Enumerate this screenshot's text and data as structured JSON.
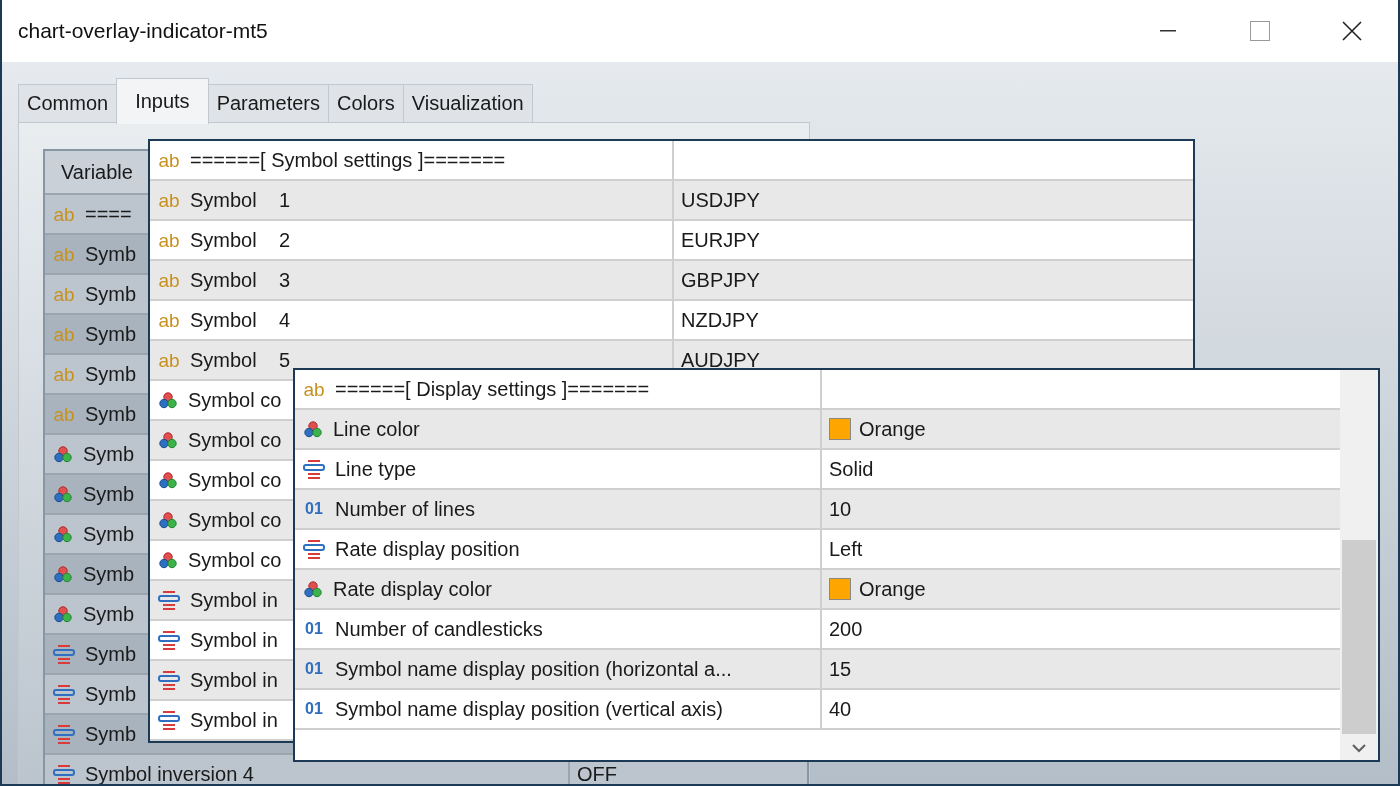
{
  "window": {
    "title": "chart-overlay-indicator-mt5"
  },
  "tabs": [
    {
      "label": "Common",
      "selected": false
    },
    {
      "label": "Inputs",
      "selected": true
    },
    {
      "label": "Parameters",
      "selected": false
    },
    {
      "label": "Colors",
      "selected": false
    },
    {
      "label": "Visualization",
      "selected": false
    }
  ],
  "background_table": {
    "columns": [
      "Variable"
    ],
    "rows": [
      {
        "kind": "string",
        "icon_text": "ab",
        "variable": "===="
      },
      {
        "kind": "string",
        "icon_text": "ab",
        "variable": "Symb"
      },
      {
        "kind": "string",
        "icon_text": "ab",
        "variable": "Symb"
      },
      {
        "kind": "string",
        "icon_text": "ab",
        "variable": "Symb"
      },
      {
        "kind": "string",
        "icon_text": "ab",
        "variable": "Symb"
      },
      {
        "kind": "string",
        "icon_text": "ab",
        "variable": "Symb"
      },
      {
        "kind": "color",
        "variable": "Symb"
      },
      {
        "kind": "color",
        "variable": "Symb"
      },
      {
        "kind": "color",
        "variable": "Symb"
      },
      {
        "kind": "color",
        "variable": "Symb"
      },
      {
        "kind": "color",
        "variable": "Symb"
      },
      {
        "kind": "enum",
        "variable": "Symb"
      },
      {
        "kind": "enum",
        "variable": "Symb"
      },
      {
        "kind": "enum",
        "variable": "Symb"
      },
      {
        "kind": "enum",
        "variable": "Symbol inversion 4",
        "value": "OFF"
      }
    ]
  },
  "symbol_settings_panel": {
    "rows": [
      {
        "kind": "string",
        "icon_text": "ab",
        "variable": "======[ Symbol settings ]======="
      },
      {
        "kind": "string",
        "icon_text": "ab",
        "variable": "Symbol    1",
        "value": "USDJPY"
      },
      {
        "kind": "string",
        "icon_text": "ab",
        "variable": "Symbol    2",
        "value": "EURJPY"
      },
      {
        "kind": "string",
        "icon_text": "ab",
        "variable": "Symbol    3",
        "value": "GBPJPY"
      },
      {
        "kind": "string",
        "icon_text": "ab",
        "variable": "Symbol    4",
        "value": "NZDJPY"
      },
      {
        "kind": "string",
        "icon_text": "ab",
        "variable": "Symbol    5",
        "value": "AUDJPY"
      },
      {
        "kind": "color",
        "variable": "Symbol co"
      },
      {
        "kind": "color",
        "variable": "Symbol co"
      },
      {
        "kind": "color",
        "variable": "Symbol co"
      },
      {
        "kind": "color",
        "variable": "Symbol co"
      },
      {
        "kind": "color",
        "variable": "Symbol co"
      },
      {
        "kind": "enum",
        "variable": "Symbol in"
      },
      {
        "kind": "enum",
        "variable": "Symbol in"
      },
      {
        "kind": "enum",
        "variable": "Symbol in"
      },
      {
        "kind": "enum",
        "variable": "Symbol in"
      }
    ]
  },
  "display_settings_panel": {
    "rows": [
      {
        "kind": "string",
        "icon_text": "ab",
        "variable": "======[ Display settings ]======="
      },
      {
        "kind": "color",
        "variable": "Line color",
        "value": "Orange",
        "color": "#ffa500"
      },
      {
        "kind": "enum",
        "variable": "Line type",
        "value": "Solid"
      },
      {
        "kind": "int",
        "icon_text": "01",
        "variable": "Number of lines",
        "value": "10"
      },
      {
        "kind": "enum",
        "variable": "Rate display position",
        "value": "Left"
      },
      {
        "kind": "color",
        "variable": "Rate display color",
        "value": "Orange",
        "color": "#ffa500"
      },
      {
        "kind": "int",
        "icon_text": "01",
        "variable": "Number of candlesticks",
        "value": "200"
      },
      {
        "kind": "int",
        "icon_text": "01",
        "variable": "Symbol name display position (horizontal a...",
        "value": "15"
      },
      {
        "kind": "int",
        "icon_text": "01",
        "variable": "Symbol name display position (vertical axis)",
        "value": "40"
      }
    ]
  }
}
